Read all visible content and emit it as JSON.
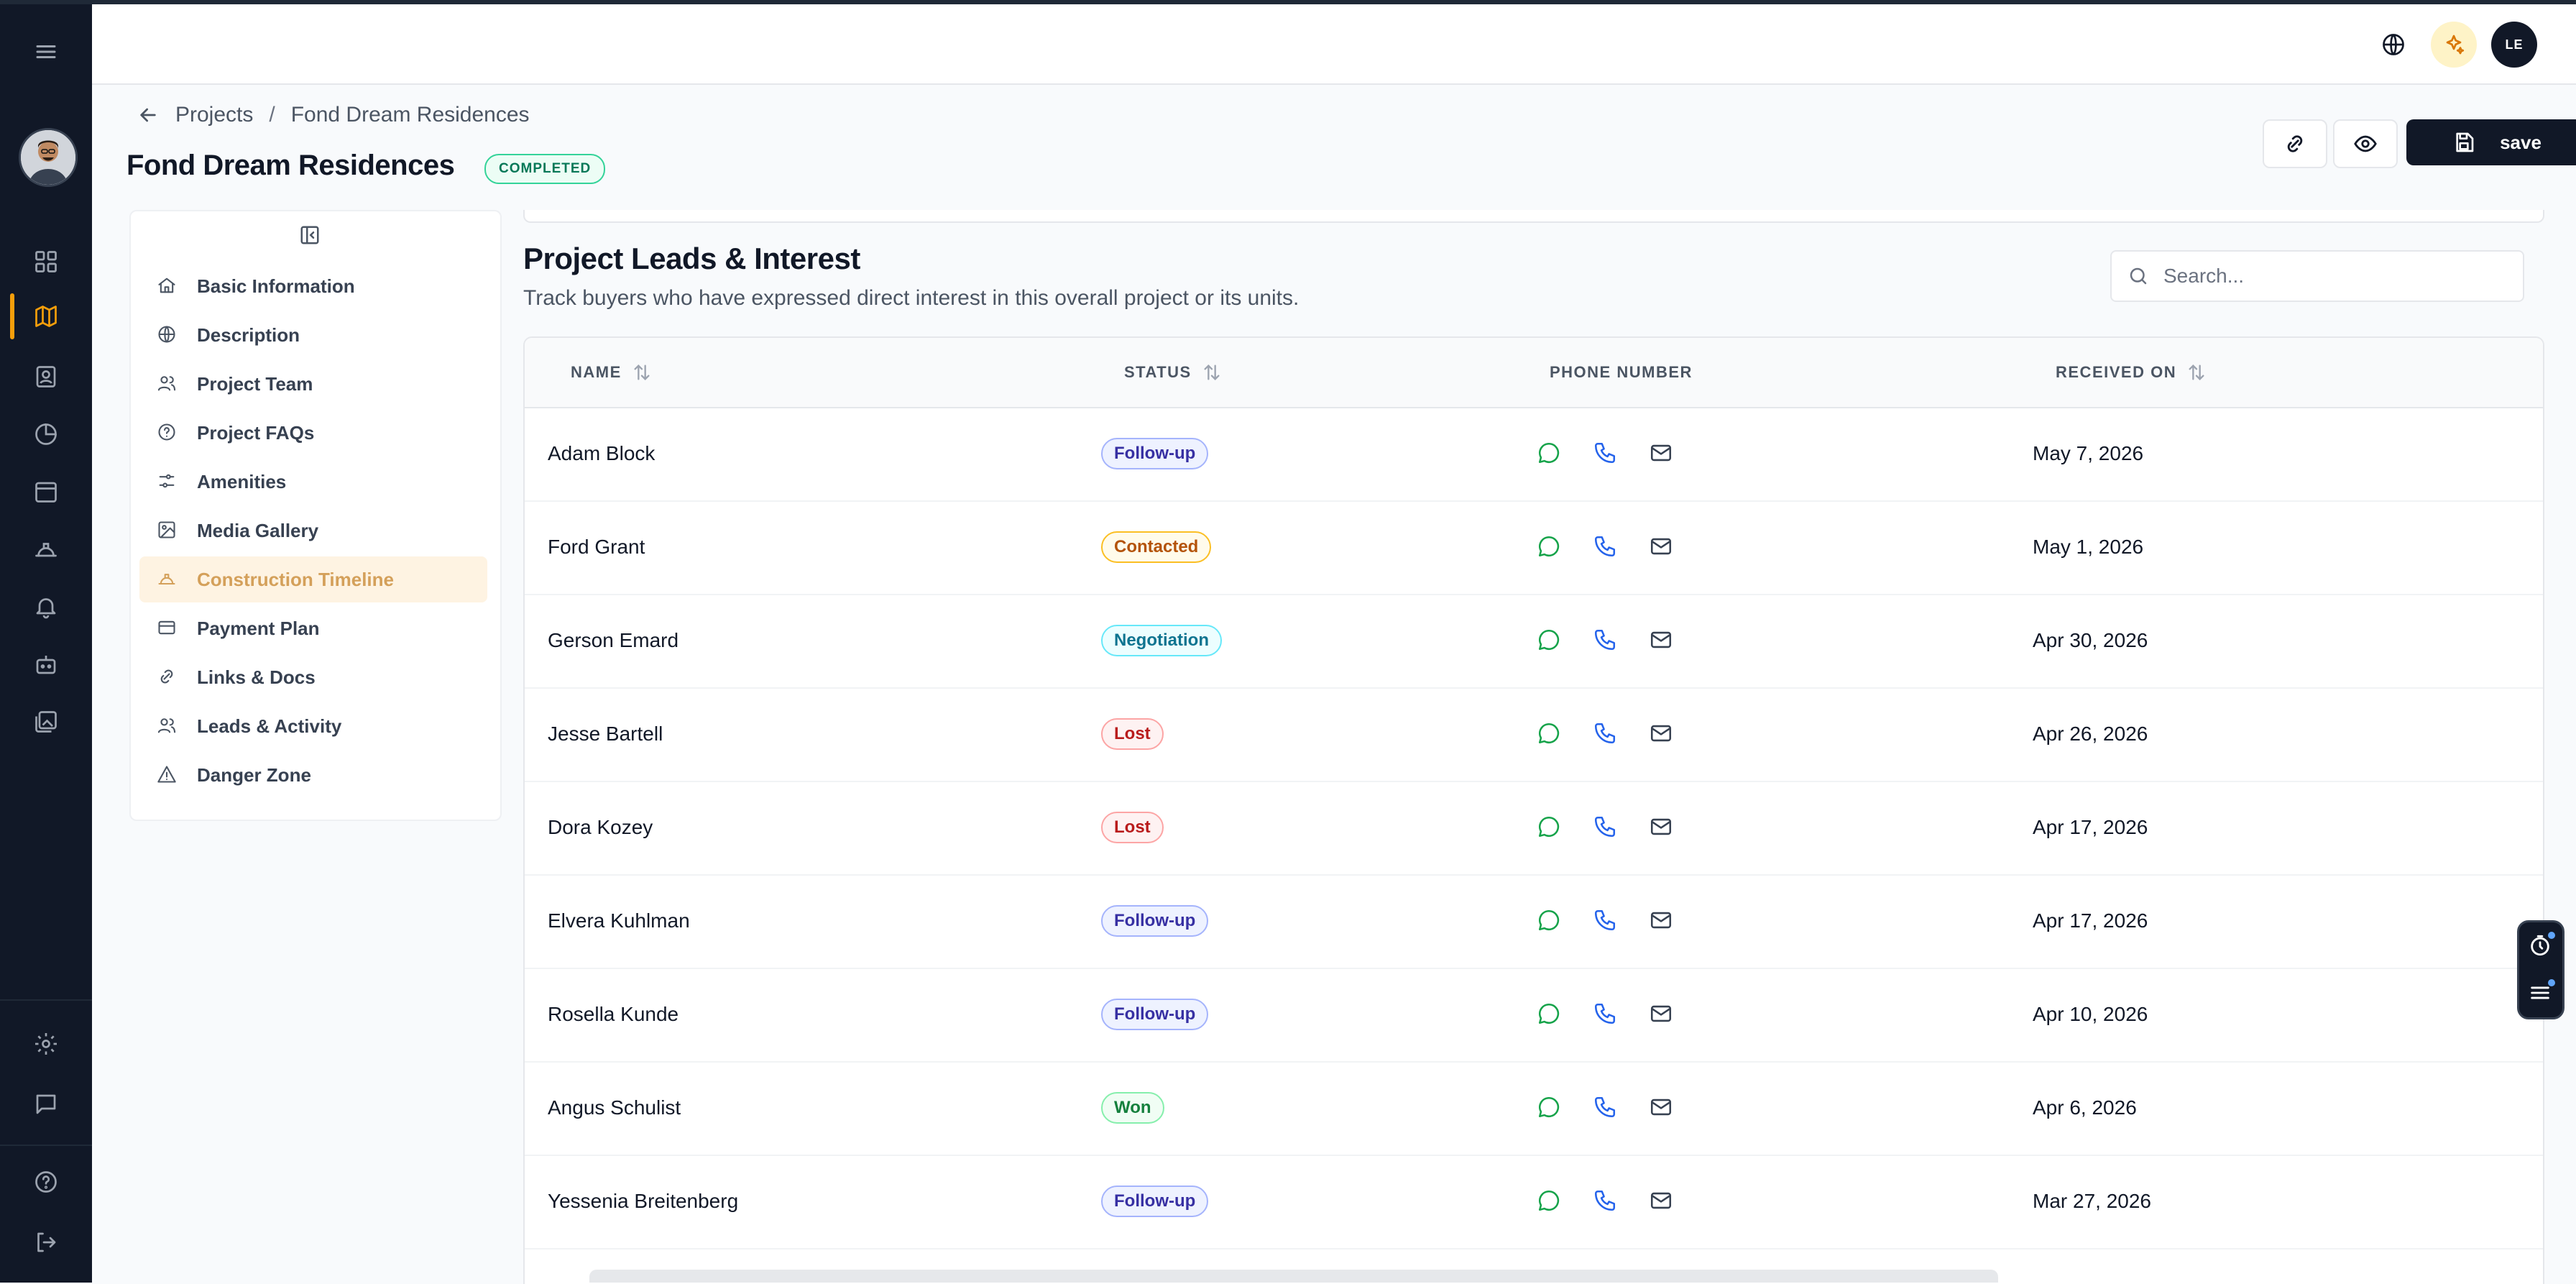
{
  "breadcrumb": {
    "root": "Projects",
    "current": "Fond Dream Residences"
  },
  "project": {
    "title": "Fond Dream Residences",
    "status_badge": "COMPLETED"
  },
  "actions": {
    "save_label": "save"
  },
  "topbar": {
    "avatar_initials": "LE"
  },
  "section_nav": [
    {
      "label": "Basic Information",
      "icon": "home-icon"
    },
    {
      "label": "Description",
      "icon": "globe-icon"
    },
    {
      "label": "Project Team",
      "icon": "users-icon"
    },
    {
      "label": "Project FAQs",
      "icon": "help-circle-icon"
    },
    {
      "label": "Amenities",
      "icon": "sliders-icon"
    },
    {
      "label": "Media Gallery",
      "icon": "image-icon"
    },
    {
      "label": "Construction Timeline",
      "icon": "hard-hat-icon",
      "active": true
    },
    {
      "label": "Payment Plan",
      "icon": "credit-card-icon"
    },
    {
      "label": "Links & Docs",
      "icon": "link-icon"
    },
    {
      "label": "Leads & Activity",
      "icon": "users-icon"
    },
    {
      "label": "Danger Zone",
      "icon": "warning-triangle-icon"
    }
  ],
  "leads": {
    "title": "Project Leads & Interest",
    "subtitle": "Track buyers who have expressed direct interest in this overall project or its units.",
    "search_placeholder": "Search...",
    "columns": {
      "name": "NAME",
      "status": "STATUS",
      "phone": "PHONE NUMBER",
      "received": "RECEIVED ON"
    },
    "rows": [
      {
        "name": "Adam Block",
        "status": "Follow-up",
        "received": "May 7, 2026"
      },
      {
        "name": "Ford Grant",
        "status": "Contacted",
        "received": "May 1, 2026"
      },
      {
        "name": "Gerson Emard",
        "status": "Negotiation",
        "received": "Apr 30, 2026"
      },
      {
        "name": "Jesse Bartell",
        "status": "Lost",
        "received": "Apr 26, 2026"
      },
      {
        "name": "Dora Kozey",
        "status": "Lost",
        "received": "Apr 17, 2026"
      },
      {
        "name": "Elvera Kuhlman",
        "status": "Follow-up",
        "received": "Apr 17, 2026"
      },
      {
        "name": "Rosella Kunde",
        "status": "Follow-up",
        "received": "Apr 10, 2026"
      },
      {
        "name": "Angus Schulist",
        "status": "Won",
        "received": "Apr 6, 2026"
      },
      {
        "name": "Yessenia Breitenberg",
        "status": "Follow-up",
        "received": "Mar 27, 2026"
      }
    ]
  },
  "status_colors": {
    "Follow-up": {
      "text": "#3730a3",
      "border": "#a5b4fc",
      "bg": "#eef2ff"
    },
    "Contacted": {
      "text": "#b45309",
      "border": "#fbbf24",
      "bg": "#fffbeb"
    },
    "Negotiation": {
      "text": "#0e7490",
      "border": "#67e8f9",
      "bg": "#ecfeff"
    },
    "Lost": {
      "text": "#b91c1c",
      "border": "#fca5a5",
      "bg": "#fef2f2"
    },
    "Won": {
      "text": "#15803d",
      "border": "#86efac",
      "bg": "#f0fdf4"
    }
  },
  "colors": {
    "accent": "#f59e0b",
    "rail_bg": "#111827",
    "whatsapp": "#16a34a",
    "phone": "#2563eb",
    "mail": "#374151"
  }
}
